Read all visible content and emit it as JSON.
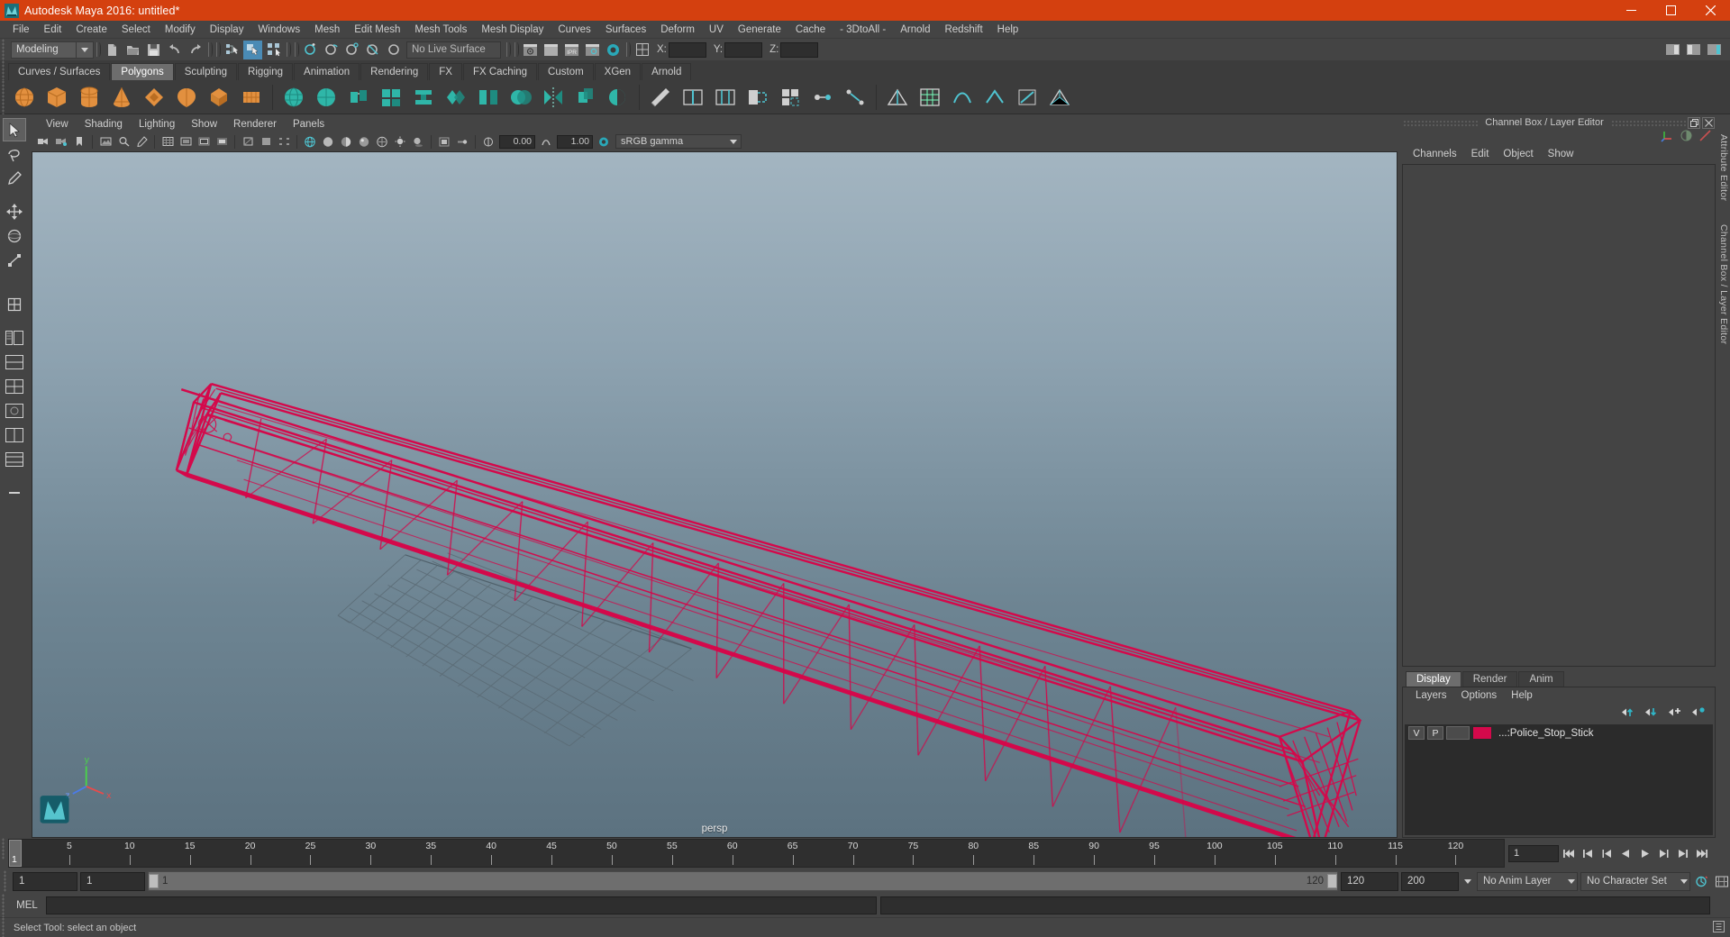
{
  "window": {
    "title": "Autodesk Maya 2016: untitled*",
    "app_icon": "maya-logo-icon",
    "minimize": "minimize-icon",
    "maximize": "maximize-icon",
    "close": "close-icon",
    "titlebar_color": "#d4400f"
  },
  "menubar": {
    "items": [
      "File",
      "Edit",
      "Create",
      "Select",
      "Modify",
      "Display",
      "Windows",
      "Mesh",
      "Edit Mesh",
      "Mesh Tools",
      "Mesh Display",
      "Curves",
      "Surfaces",
      "Deform",
      "UV",
      "Generate",
      "Cache",
      "- 3DtoAll -",
      "Arnold",
      "Redshift",
      "Help"
    ]
  },
  "statusline": {
    "menu_set": "Modeling",
    "live_surface": "No Live Surface",
    "coord_labels": [
      "X:",
      "Y:",
      "Z:"
    ],
    "coord_values": [
      "",
      "",
      ""
    ],
    "icons": [
      "new-scene-icon",
      "open-scene-icon",
      "save-scene-icon",
      "undo-icon",
      "redo-icon",
      "select-hierarchy-icon",
      "select-object-icon",
      "select-component-icon",
      "snap-grid-icon",
      "snap-curve-icon",
      "snap-point-icon",
      "snap-projected-center-icon",
      "snap-view-plane-icon",
      "make-live-icon",
      "render-current-frame-icon",
      "render-sequence-icon",
      "ipr-render-icon",
      "render-settings-icon",
      "hypershade-icon",
      "show-hide-editors-icon",
      "attribute-editor-icon",
      "tool-settings-icon",
      "channel-box-icon"
    ],
    "active_icon_index": 6
  },
  "shelf": {
    "tabs": [
      "Curves / Surfaces",
      "Polygons",
      "Sculpting",
      "Rigging",
      "Animation",
      "Rendering",
      "FX",
      "FX Caching",
      "Custom",
      "XGen",
      "Arnold"
    ],
    "active_tab": "Polygons",
    "buttons": [
      "poly-sphere-icon",
      "poly-cube-icon",
      "poly-cylinder-icon",
      "poly-cone-icon",
      "poly-torus-icon",
      "poly-plane-icon",
      "poly-prism-icon",
      "poly-pyramid-icon",
      "sculpt-geometry-icon",
      "smooth-icon",
      "extrude-icon",
      "bevel-icon",
      "bridge-icon",
      "combine-icon",
      "separate-icon",
      "booleans-icon",
      "mirror-icon",
      "boolean-union-icon",
      "boolean-difference-icon",
      "multi-cut-icon",
      "insert-edge-loop-icon",
      "offset-edge-loop-icon",
      "append-polygon-icon",
      "quad-draw-icon",
      "target-weld-icon",
      "connect-icon",
      "crease-tool-icon",
      "uv-editor-icon",
      "soften-edge-icon",
      "harden-edge-icon",
      "cleanup-icon",
      "triangulate-icon"
    ]
  },
  "toolbox": {
    "items": [
      "select-tool-icon",
      "lasso-select-tool-icon",
      "paint-select-tool-icon",
      "move-tool-icon",
      "rotate-tool-icon",
      "scale-tool-icon",
      "last-tool-icon",
      "view-four-panes-icon",
      "view-outliner-persp-icon",
      "view-persp-graph-icon",
      "view-hypershade-persp-icon",
      "view-persp-only-icon",
      "view-two-panes-icon"
    ],
    "active_item": "select-tool-icon"
  },
  "viewport": {
    "panel_menu": [
      "View",
      "Shading",
      "Lighting",
      "Show",
      "Renderer",
      "Panels"
    ],
    "camera_label": "persp",
    "toolbar_values": {
      "exposure": "0.00",
      "gamma": "1.00",
      "color_management": "sRGB gamma"
    },
    "toolbar_icons": [
      "select-camera-icon",
      "camera-attributes-icon",
      "bookmark-icon",
      "image-plane-icon",
      "two-d-pan-zoom-icon",
      "grease-pencil-icon",
      "grid-toggle-icon",
      "film-gate-icon",
      "resolution-gate-icon",
      "gate-mask-icon",
      "exposure-icon",
      "hud-icon",
      "wireframe-shading-icon",
      "smooth-shade-all-icon",
      "smooth-shade-selected-icon",
      "flat-shade-icon",
      "bounding-box-icon",
      "textured-icon",
      "use-all-lights-icon",
      "shadows-icon",
      "screen-space-ao-icon",
      "motion-blur-icon",
      "isolate-select-icon",
      "xray-icon",
      "xray-joints-icon",
      "xray-active-components-icon",
      "exposure-icon-2",
      "gamma-icon"
    ],
    "gizmo_axes": [
      "y",
      "x",
      "z"
    ],
    "model_name": "Police_Stop_Stick",
    "wireframe_color": "#d4094b",
    "background_top": "#9fb2bf",
    "background_bottom": "#5d7280"
  },
  "channel_box": {
    "panel_title": "Channel Box / Layer Editor",
    "menu": [
      "Channels",
      "Edit",
      "Object",
      "Show"
    ],
    "icons": [
      "channel-box-axis-icon",
      "channel-box-half-icon",
      "channel-box-anim-icon"
    ],
    "window_buttons": [
      "undock-icon",
      "close-panel-icon"
    ],
    "content": ""
  },
  "layer_editor": {
    "tabs": [
      "Display",
      "Render",
      "Anim"
    ],
    "active_tab": "Display",
    "menu": [
      "Layers",
      "Options",
      "Help"
    ],
    "buttons": [
      "move-layer-up-icon",
      "move-layer-down-icon",
      "new-layer-icon",
      "new-layer-from-selected-icon"
    ],
    "layers": [
      {
        "visibility": "V",
        "playback": "P",
        "type": "",
        "color": "#d4094b",
        "name": "...:Police_Stop_Stick"
      }
    ]
  },
  "attribute_strip": {
    "labels": [
      "Attribute Editor",
      "Channel Box / Layer Editor"
    ]
  },
  "timeline": {
    "start_label": "1",
    "ticks": [
      5,
      10,
      15,
      20,
      25,
      30,
      35,
      40,
      45,
      50,
      55,
      60,
      65,
      70,
      75,
      80,
      85,
      90,
      95,
      100,
      105,
      110,
      115,
      120
    ],
    "current_frame": "1",
    "frame_field": "1",
    "range_start": "1",
    "range_end": "1",
    "range_slider_start": "1",
    "range_slider_end": "120",
    "anim_end": "120",
    "playback_end": "200",
    "anim_layer": "No Anim Layer",
    "character_set": "No Character Set",
    "playback_icons": [
      "go-to-start-icon",
      "step-back-frame-icon",
      "step-back-key-icon",
      "play-backwards-icon",
      "play-forwards-icon",
      "step-forward-key-icon",
      "step-forward-frame-icon",
      "go-to-end-icon"
    ],
    "auto_key_icon": "auto-keyframe-icon",
    "anim_prefs_icon": "animation-preferences-icon"
  },
  "command_line": {
    "label": "MEL",
    "value": "",
    "result": ""
  },
  "status_bar": {
    "message": "Select Tool: select an object",
    "help_icon": "help-icon"
  }
}
